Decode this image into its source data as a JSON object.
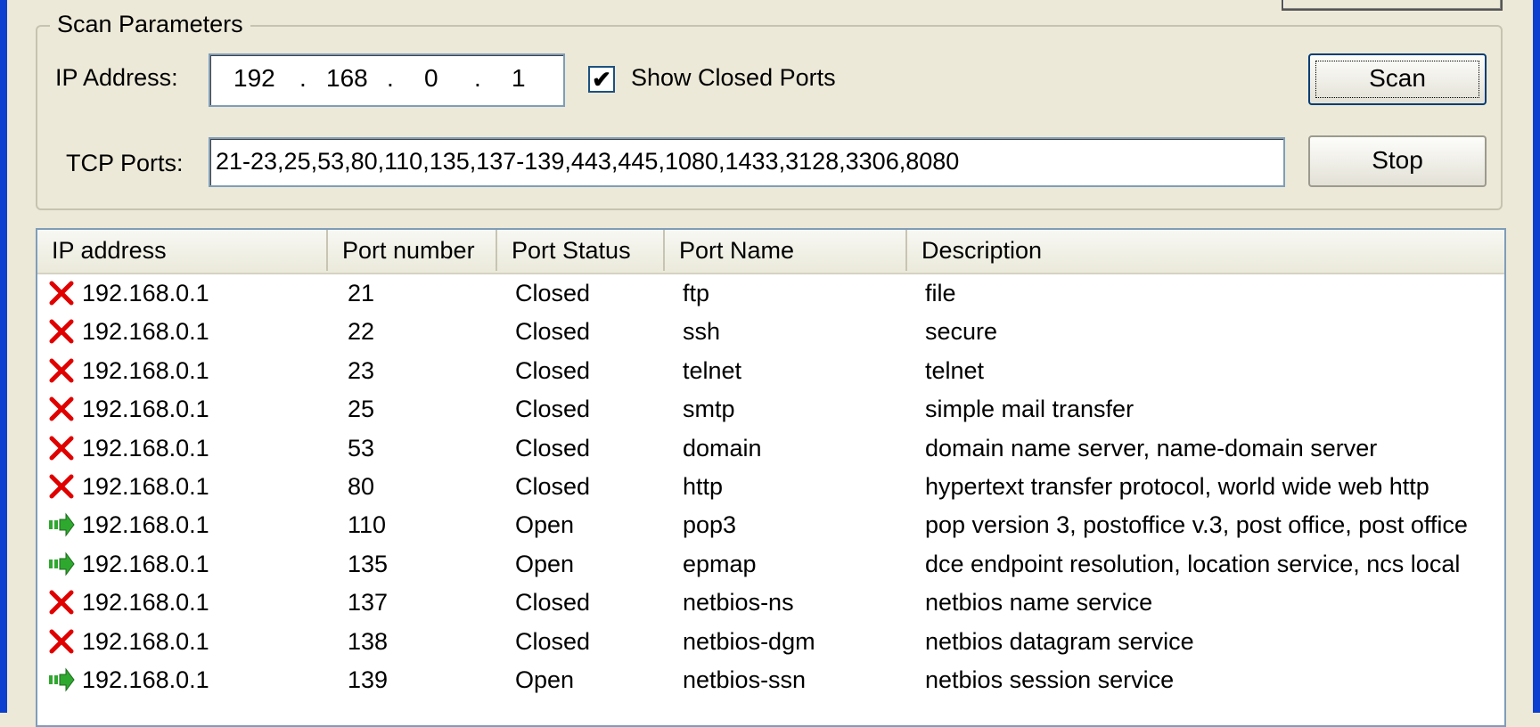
{
  "scan_parameters": {
    "title": "Scan Parameters",
    "ip_label": "IP Address:",
    "ip_parts": [
      "192",
      "168",
      "0",
      "1"
    ],
    "show_closed_label": "Show Closed Ports",
    "show_closed_checked": true,
    "tcp_ports_label": "TCP Ports:",
    "tcp_ports_value": "21-23,25,53,80,110,135,137-139,443,445,1080,1433,3128,3306,8080",
    "scan_label": "Scan",
    "stop_label": "Stop"
  },
  "results": {
    "columns": [
      "IP address",
      "Port number",
      "Port Status",
      "Port Name",
      "Description"
    ],
    "rows": [
      {
        "status_icon": "closed-x-icon",
        "ip": "192.168.0.1",
        "port": "21",
        "status": "Closed",
        "name": "ftp",
        "description": "file"
      },
      {
        "status_icon": "closed-x-icon",
        "ip": "192.168.0.1",
        "port": "22",
        "status": "Closed",
        "name": "ssh",
        "description": "secure"
      },
      {
        "status_icon": "closed-x-icon",
        "ip": "192.168.0.1",
        "port": "23",
        "status": "Closed",
        "name": "telnet",
        "description": "telnet"
      },
      {
        "status_icon": "closed-x-icon",
        "ip": "192.168.0.1",
        "port": "25",
        "status": "Closed",
        "name": "smtp",
        "description": "simple mail transfer"
      },
      {
        "status_icon": "closed-x-icon",
        "ip": "192.168.0.1",
        "port": "53",
        "status": "Closed",
        "name": "domain",
        "description": "domain name server, name-domain server"
      },
      {
        "status_icon": "closed-x-icon",
        "ip": "192.168.0.1",
        "port": "80",
        "status": "Closed",
        "name": "http",
        "description": "hypertext transfer protocol, world wide web http"
      },
      {
        "status_icon": "open-arrow-icon",
        "ip": "192.168.0.1",
        "port": "110",
        "status": "Open",
        "name": "pop3",
        "description": "pop version 3, postoffice v.3, post office, post office"
      },
      {
        "status_icon": "open-arrow-icon",
        "ip": "192.168.0.1",
        "port": "135",
        "status": "Open",
        "name": "epmap",
        "description": "dce endpoint resolution, location service, ncs local"
      },
      {
        "status_icon": "closed-x-icon",
        "ip": "192.168.0.1",
        "port": "137",
        "status": "Closed",
        "name": "netbios-ns",
        "description": "netbios name service"
      },
      {
        "status_icon": "closed-x-icon",
        "ip": "192.168.0.1",
        "port": "138",
        "status": "Closed",
        "name": "netbios-dgm",
        "description": "netbios datagram service"
      },
      {
        "status_icon": "open-arrow-icon",
        "ip": "192.168.0.1",
        "port": "139",
        "status": "Open",
        "name": "netbios-ssn",
        "description": "netbios session service"
      }
    ]
  },
  "colors": {
    "closed_icon": "#e00000",
    "open_icon": "#2fa82f",
    "window_frame": "#0a3fd0",
    "face": "#ece9d8"
  }
}
